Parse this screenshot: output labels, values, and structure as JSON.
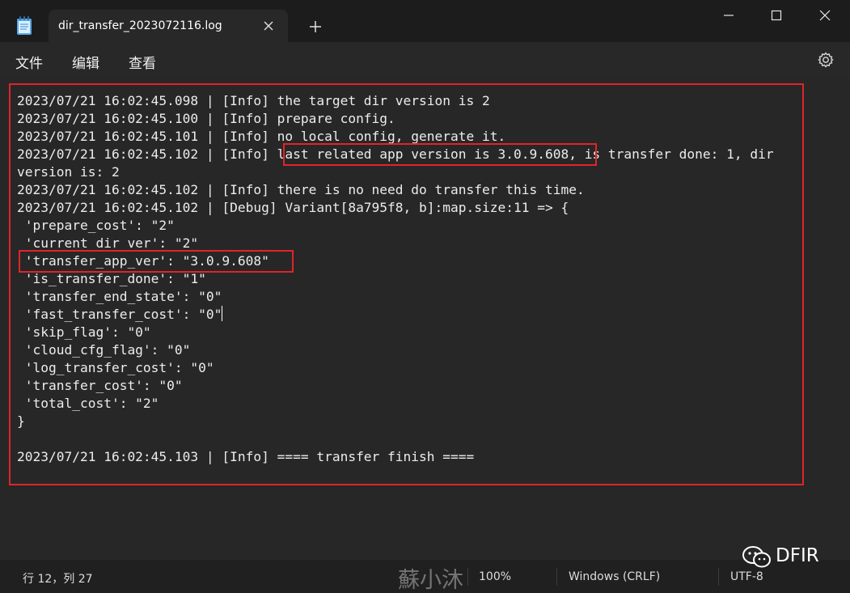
{
  "window": {
    "tab_title": "dir_transfer_2023072116.log",
    "colors": {
      "titlebar": "#1c1c1c",
      "editor": "#272727",
      "highlight": "#e0242a"
    }
  },
  "menu": {
    "file": "文件",
    "edit": "编辑",
    "view": "查看"
  },
  "editor": {
    "lines": [
      "2023/07/21 16:02:45.098 | [Info] the target dir version is 2",
      "2023/07/21 16:02:45.100 | [Info] prepare config.",
      "2023/07/21 16:02:45.101 | [Info] no local config, generate it.",
      "2023/07/21 16:02:45.102 | [Info] last related app version is 3.0.9.608, is transfer done: 1, dir",
      "version is: 2",
      "2023/07/21 16:02:45.102 | [Info] there is no need do transfer this time.",
      "2023/07/21 16:02:45.102 | [Debug] Variant[8a795f8, b]:map.size:11 => {",
      " 'prepare_cost': \"2\"",
      " 'current_dir_ver': \"2\"",
      " 'transfer_app_ver': \"3.0.9.608\"",
      " 'is_transfer_done': \"1\"",
      " 'transfer_end_state': \"0\"",
      " 'fast_transfer_cost': \"0\"",
      " 'skip_flag': \"0\"",
      " 'cloud_cfg_flag': \"0\"",
      " 'log_transfer_cost': \"0\"",
      " 'transfer_cost': \"0\"",
      " 'total_cost': \"2\"",
      "}",
      "",
      "2023/07/21 16:02:45.103 | [Info] ==== transfer finish ===="
    ]
  },
  "status": {
    "position": "行 12，列 27",
    "zoom": "100%",
    "line_ending": "Windows (CRLF)",
    "encoding": "UTF-8"
  },
  "watermark": {
    "author": "蘇小沐",
    "brand": "DFIR"
  }
}
